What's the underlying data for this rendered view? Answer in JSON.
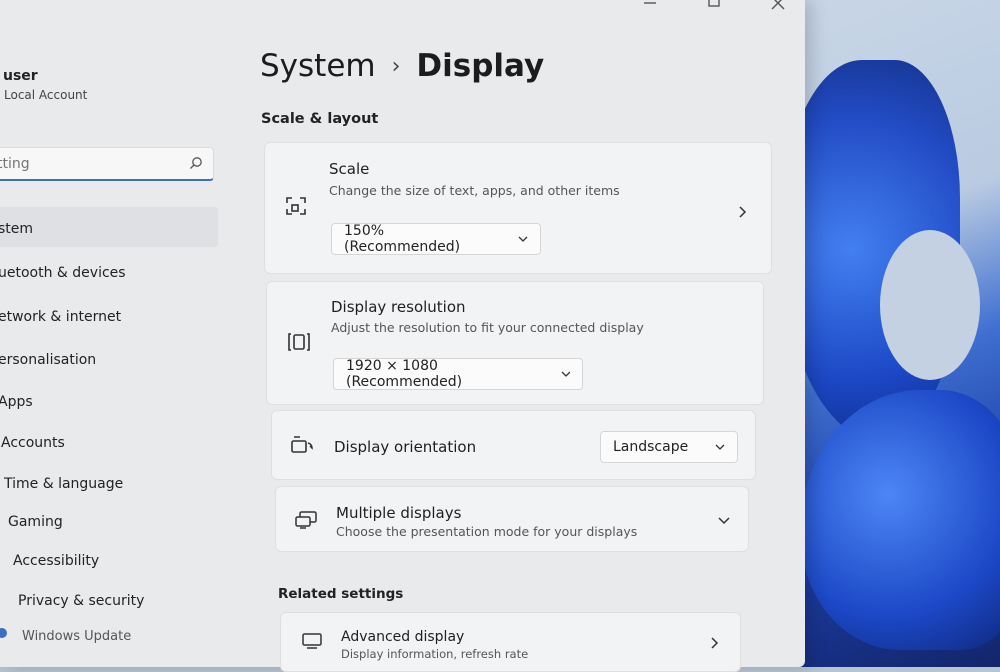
{
  "user": {
    "name": "user",
    "account_type": "Local Account"
  },
  "search": {
    "placeholder": "tting"
  },
  "sidebar": {
    "items": [
      {
        "label": "stem"
      },
      {
        "label": "uetooth & devices"
      },
      {
        "label": "etwork & internet"
      },
      {
        "label": "ersonalisation"
      },
      {
        "label": "Apps"
      },
      {
        "label": "Accounts"
      },
      {
        "label": "Time & language"
      },
      {
        "label": "Gaming"
      },
      {
        "label": "Accessibility"
      },
      {
        "label": "Privacy & security"
      },
      {
        "label": "Windows Update"
      }
    ]
  },
  "breadcrumb": {
    "parent": "System",
    "separator": "›",
    "current": "Display"
  },
  "scale_layout": {
    "heading": "Scale & layout",
    "scale": {
      "title": "Scale",
      "subtitle": "Change the size of text, apps, and other items",
      "value": "150% (Recommended)"
    },
    "resolution": {
      "title": "Display resolution",
      "subtitle": "Adjust the resolution to fit your connected display",
      "value": "1920 × 1080 (Recommended)"
    },
    "orientation": {
      "title": "Display orientation",
      "value": "Landscape"
    },
    "multiple": {
      "title": "Multiple displays",
      "subtitle": "Choose the presentation mode for your displays"
    }
  },
  "related": {
    "heading": "Related settings",
    "advanced": {
      "title": "Advanced display",
      "subtitle": "Display information, refresh rate"
    }
  },
  "colors": {
    "accent": "#3c6fbf",
    "window_bg": "#e9eaec",
    "card_bg": "#f2f3f4"
  }
}
